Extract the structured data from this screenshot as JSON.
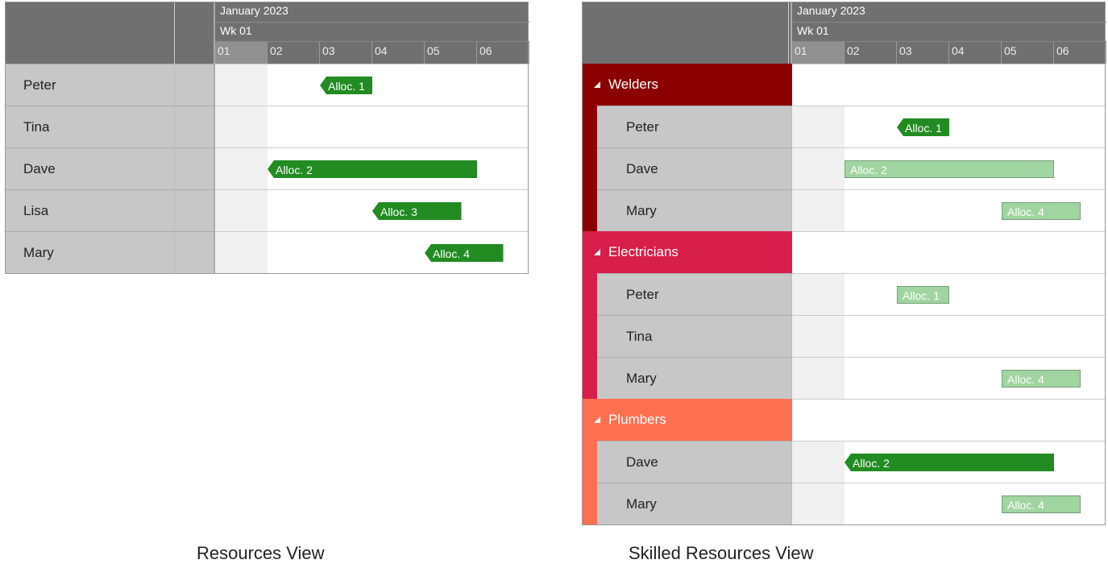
{
  "timeline": {
    "month": "January 2023",
    "week": "Wk 01",
    "days": [
      "01",
      "02",
      "03",
      "04",
      "05",
      "06"
    ]
  },
  "colors": {
    "alloc_solid": "#228b22",
    "alloc_faded": "#a0d4a0",
    "welders": "#8b0000",
    "electricians": "#d81e4a",
    "plumbers": "#ff7050"
  },
  "left": {
    "caption": "Resources View",
    "rows": [
      {
        "name": "Peter",
        "alloc": {
          "label": "Alloc. 1",
          "startDay": 2,
          "span": 1,
          "style": "solid",
          "shape": "arrow"
        }
      },
      {
        "name": "Tina"
      },
      {
        "name": "Dave",
        "alloc": {
          "label": "Alloc. 2",
          "startDay": 1,
          "span": 4,
          "style": "solid",
          "shape": "arrow"
        }
      },
      {
        "name": "Lisa",
        "alloc": {
          "label": "Alloc. 3",
          "startDay": 3,
          "span": 1.7,
          "style": "solid",
          "shape": "arrow"
        }
      },
      {
        "name": "Mary",
        "alloc": {
          "label": "Alloc. 4",
          "startDay": 4,
          "span": 1.5,
          "style": "solid",
          "shape": "arrow"
        }
      }
    ]
  },
  "right": {
    "caption": "Skilled Resources View",
    "groups": [
      {
        "name": "Welders",
        "color": "welders",
        "members": [
          {
            "name": "Peter",
            "alloc": {
              "label": "Alloc. 1",
              "startDay": 2,
              "span": 1,
              "style": "solid",
              "shape": "arrow"
            }
          },
          {
            "name": "Dave",
            "alloc": {
              "label": "Alloc. 2",
              "startDay": 1,
              "span": 4,
              "style": "faded",
              "shape": "block"
            }
          },
          {
            "name": "Mary",
            "alloc": {
              "label": "Alloc. 4",
              "startDay": 4,
              "span": 1.5,
              "style": "faded",
              "shape": "block"
            }
          }
        ]
      },
      {
        "name": "Electricians",
        "color": "electricians",
        "members": [
          {
            "name": "Peter",
            "alloc": {
              "label": "Alloc. 1",
              "startDay": 2,
              "span": 1,
              "style": "faded",
              "shape": "block"
            }
          },
          {
            "name": "Tina"
          },
          {
            "name": "Mary",
            "alloc": {
              "label": "Alloc. 4",
              "startDay": 4,
              "span": 1.5,
              "style": "faded",
              "shape": "block"
            }
          }
        ]
      },
      {
        "name": "Plumbers",
        "color": "plumbers",
        "members": [
          {
            "name": "Dave",
            "alloc": {
              "label": "Alloc. 2",
              "startDay": 1,
              "span": 4,
              "style": "solid",
              "shape": "arrow"
            }
          },
          {
            "name": "Mary",
            "alloc": {
              "label": "Alloc. 4",
              "startDay": 4,
              "span": 1.5,
              "style": "faded",
              "shape": "block"
            }
          }
        ]
      }
    ]
  }
}
